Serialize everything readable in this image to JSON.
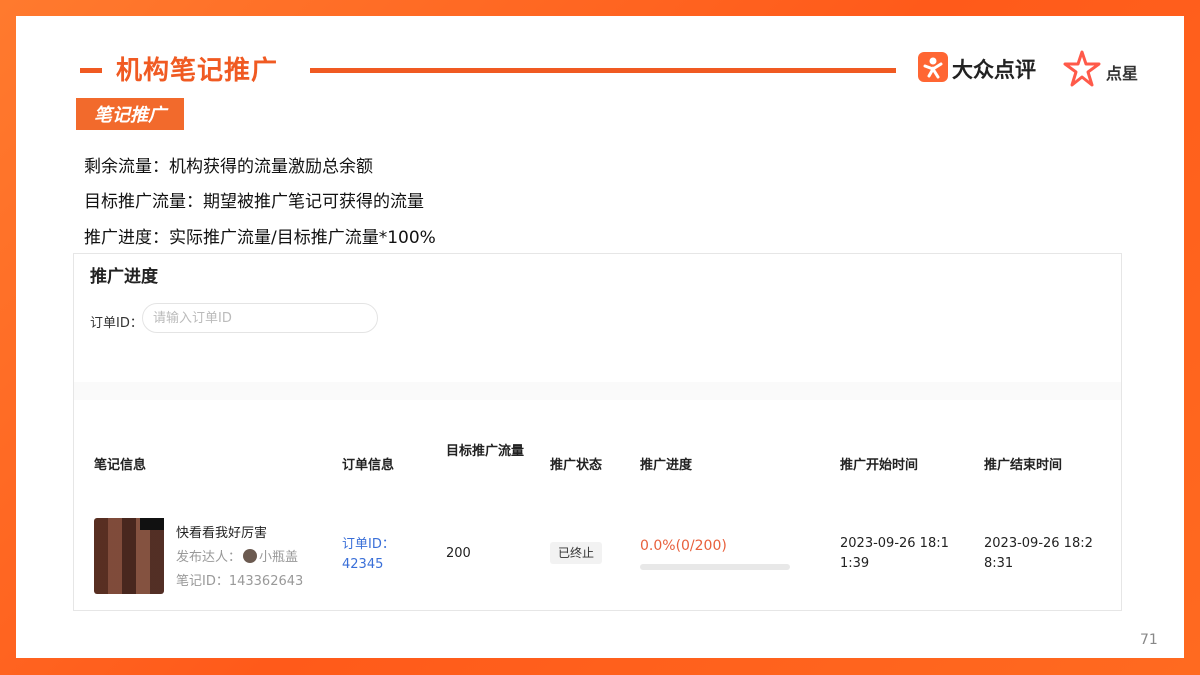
{
  "header": {
    "title": "机构笔记推广",
    "brand_dianping": "大众点评",
    "brand_dianxing": "点星"
  },
  "section_badge": "笔记推广",
  "definitions": [
    "剩余流量：机构获得的流量激励总余额",
    "目标推广流量：期望被推广笔记可获得的流量",
    "推广进度：实际推广流量/目标推广流量*100%"
  ],
  "panel": {
    "title": "推广进度",
    "order_label": "订单ID：",
    "order_placeholder": "请输入订单ID",
    "columns": {
      "note_info": "笔记信息",
      "order_info": "订单信息",
      "target_traffic": "目标推广流量",
      "status": "推广状态",
      "progress": "推广进度",
      "start_time": "推广开始时间",
      "end_time": "推广结束时间"
    },
    "row": {
      "note_title": "快看看我好厉害",
      "author_label": "发布达人：",
      "author_name": "小瓶盖",
      "note_id": "笔记ID：143362643",
      "order_id": "订单ID：42345",
      "target_traffic": "200",
      "status": "已终止",
      "progress_text": "0.0%(0/200)",
      "progress_fraction": 0.0,
      "start_time": "2023-09-26 18:11:39",
      "end_time": "2023-09-26 18:28:31"
    }
  },
  "page_number": "71",
  "colors": {
    "accent": "#f05a22",
    "progress": "#e8603c",
    "link": "#3a6fd8"
  }
}
